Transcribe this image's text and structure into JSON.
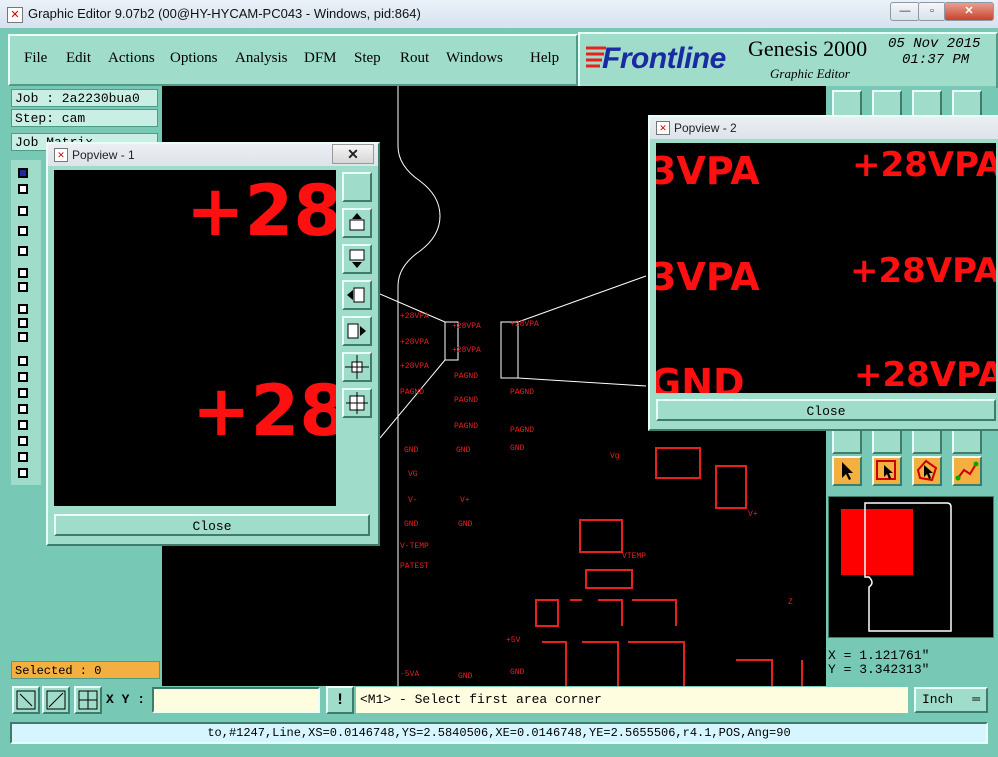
{
  "window": {
    "title": "Graphic Editor 9.07b2 (00@HY-HYCAM-PC043 - Windows, pid:864)",
    "minimize": "—",
    "maximize": "▫",
    "close": "✕"
  },
  "menu": {
    "items": [
      {
        "label": "File"
      },
      {
        "label": "Edit"
      },
      {
        "label": "Actions"
      },
      {
        "label": "Options"
      },
      {
        "label": "Analysis"
      },
      {
        "label": "DFM"
      },
      {
        "label": "Step"
      },
      {
        "label": "Rout"
      },
      {
        "label": "Windows"
      },
      {
        "label": "Help"
      }
    ]
  },
  "brand": {
    "logo": "Frontline",
    "product": "Genesis 2000",
    "subtitle": "Graphic Editor",
    "date": "05 Nov 2015",
    "time": "01:37 PM"
  },
  "left": {
    "job": "Job : 2a2230bua0",
    "step": "Step: cam",
    "job_matrix": "Job Matrix",
    "selected": "Selected : 0"
  },
  "popview1": {
    "title": "Popview - 1",
    "close_x": "✕",
    "close": "Close",
    "labels": [
      "+28",
      "+28"
    ]
  },
  "popview2": {
    "title": "Popview - 2",
    "close": "Close",
    "labels": [
      "3VPA",
      "+28VPA",
      "3VPA",
      "+28VPA",
      "GND",
      "+28VPA"
    ]
  },
  "canvas": {
    "labels": [
      "+28VPA",
      "+28VPA",
      "+28VPA",
      "+28VPA",
      "+28VPA",
      "+28VPA",
      "PAGND",
      "PAGND",
      "PAGND",
      "PAGND",
      "PAGND",
      "PAGND",
      "GND",
      "GND",
      "GND",
      "VG",
      "V-",
      "V+",
      "GND",
      "GND",
      "V-TEMP",
      "PATEST",
      "V+",
      "Vg",
      "VTEMP",
      "Z",
      "+5V",
      "GND",
      "-5VA",
      "GND"
    ]
  },
  "coords": {
    "x": "X = 1.121761\"",
    "y": "Y = 3.342313\""
  },
  "bottom": {
    "xy_label": "X Y :",
    "xy_value": "",
    "warn": "!",
    "prompt": "<M1> - Select first area corner",
    "units": "Inch"
  },
  "status": "to,#1247,Line,XS=0.0146748,YS=2.5840506,XE=0.0146748,YE=2.5655506,r4.1,POS,Ang=90",
  "colors": {
    "panel": "#77c8b4",
    "panel_light": "#9fdcc9",
    "feature_red": "#e8201e",
    "selected_bg": "#f3b040",
    "brand_blue": "#1a2aa0"
  }
}
